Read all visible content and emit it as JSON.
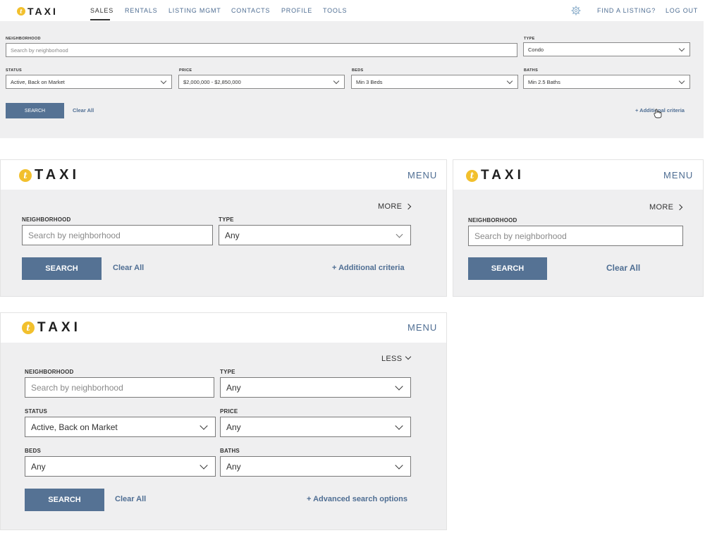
{
  "brand": {
    "logo_letter": "t",
    "logo_text": "TAXI",
    "logo_color": "#f2c02d"
  },
  "colors": {
    "accent": "#557294",
    "link": "#4f6e93",
    "panel_bg": "#efeff0"
  },
  "desktop": {
    "nav": [
      "SALES",
      "RENTALS",
      "LISTING MGMT",
      "CONTACTS",
      "PROFILE",
      "TOOLS"
    ],
    "nav_active": "SALES",
    "settings_icon": "gear-icon",
    "find_listing": "FIND A LISTING?",
    "log_out": "LOG OUT",
    "neighborhood": {
      "label": "NEIGHBORHOOD",
      "placeholder": "Search by neighborhood"
    },
    "type": {
      "label": "TYPE",
      "value": "Condo"
    },
    "status": {
      "label": "STATUS",
      "value": "Active, Back on Market"
    },
    "price": {
      "label": "PRICE",
      "value": "$2,000,000 - $2,850,000"
    },
    "beds": {
      "label": "BEDS",
      "value": "Min 3 Beds"
    },
    "baths": {
      "label": "BATHS",
      "value": "Min 2.5 Baths"
    },
    "search": "SEARCH",
    "clear": "Clear All",
    "additional": "+ Additional criteria"
  },
  "tablet": {
    "menu": "MENU",
    "more": "MORE",
    "neighborhood": {
      "label": "NEIGHBORHOOD",
      "placeholder": "Search by neighborhood"
    },
    "type": {
      "label": "TYPE",
      "value": "Any"
    },
    "search": "SEARCH",
    "clear": "Clear All",
    "additional": "+ Additional criteria"
  },
  "mobile": {
    "menu": "MENU",
    "more": "MORE",
    "neighborhood": {
      "label": "NEIGHBORHOOD",
      "placeholder": "Search by neighborhood"
    },
    "search": "SEARCH",
    "clear": "Clear All"
  },
  "expanded": {
    "menu": "MENU",
    "less": "LESS",
    "neighborhood": {
      "label": "NEIGHBORHOOD",
      "placeholder": "Search by neighborhood"
    },
    "type": {
      "label": "TYPE",
      "value": "Any"
    },
    "status": {
      "label": "STATUS",
      "value": "Active, Back on Market"
    },
    "price": {
      "label": "PRICE",
      "value": "Any"
    },
    "beds": {
      "label": "BEDS",
      "value": "Any"
    },
    "baths": {
      "label": "BATHS",
      "value": "Any"
    },
    "search": "SEARCH",
    "clear": "Clear All",
    "advanced": "+ Advanced search options"
  }
}
